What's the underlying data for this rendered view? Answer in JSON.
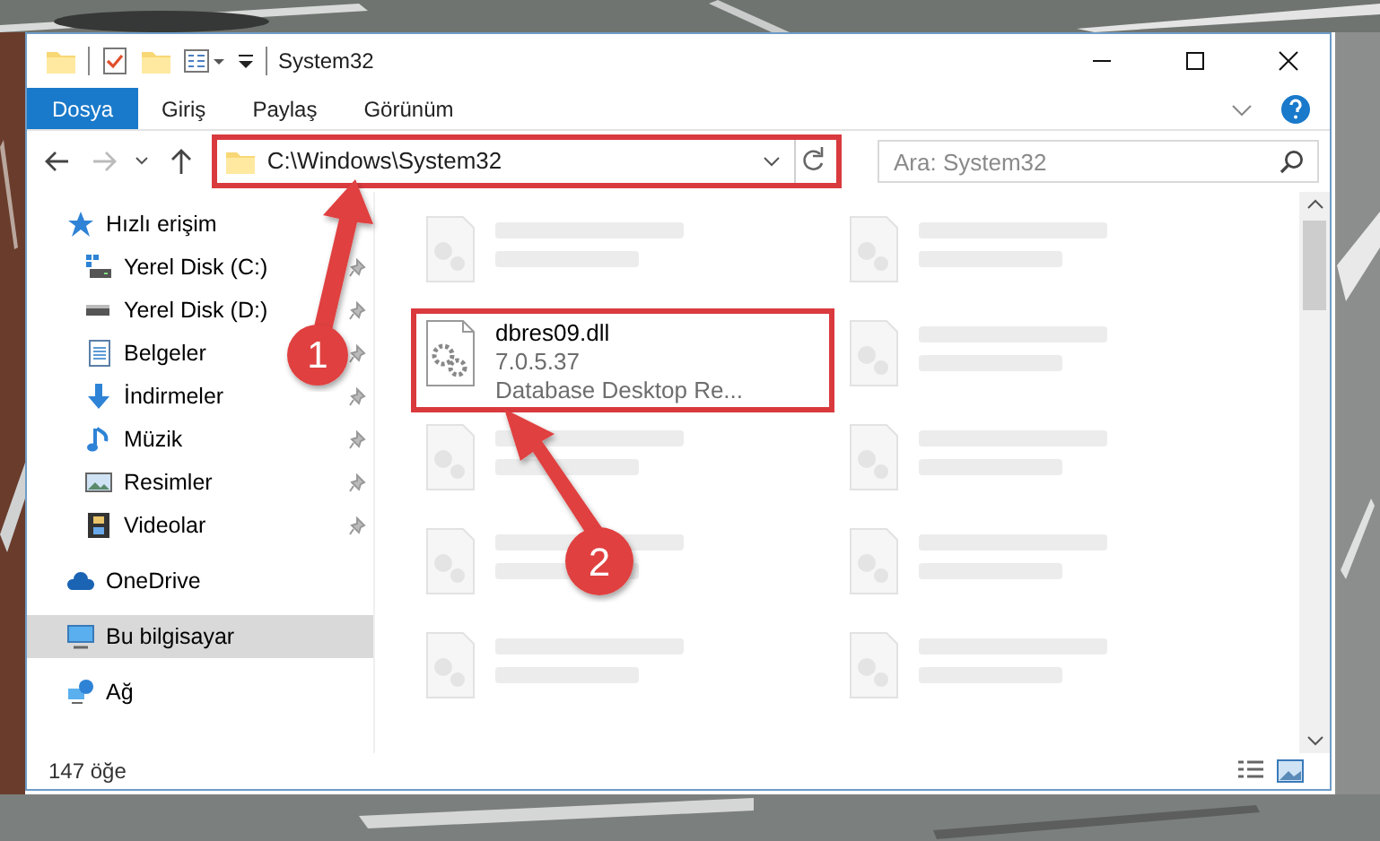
{
  "window": {
    "title": "System32"
  },
  "ribbon_tabs": [
    {
      "label": "Dosya",
      "kind": "file"
    },
    {
      "label": "Giriş",
      "kind": "tab"
    },
    {
      "label": "Paylaş",
      "kind": "tab"
    },
    {
      "label": "Görünüm",
      "kind": "tab"
    }
  ],
  "address": {
    "path": "C:\\Windows\\System32",
    "highlighted": true
  },
  "search": {
    "placeholder": "Ara: System32"
  },
  "sidebar": {
    "items": [
      {
        "label": "Hızlı erişim",
        "kind": "star",
        "selected": false,
        "children": [
          {
            "label": "Yerel Disk (C:)",
            "kind": "sysdrive",
            "pinned": true,
            "selected": false
          },
          {
            "label": "Yerel Disk (D:)",
            "kind": "drive",
            "pinned": true,
            "selected": false
          },
          {
            "label": "Belgeler",
            "kind": "docs",
            "pinned": true,
            "selected": false
          },
          {
            "label": "İndirmeler",
            "kind": "download",
            "pinned": true,
            "selected": false
          },
          {
            "label": "Müzik",
            "kind": "music",
            "pinned": true,
            "selected": false
          },
          {
            "label": "Resimler",
            "kind": "pictures",
            "pinned": true,
            "selected": false
          },
          {
            "label": "Videolar",
            "kind": "videos",
            "pinned": true,
            "selected": false
          }
        ]
      },
      {
        "label": "OneDrive",
        "kind": "cloud",
        "selected": false
      },
      {
        "label": "Bu bilgisayar",
        "kind": "pc",
        "selected": true
      },
      {
        "label": "Ağ",
        "kind": "network",
        "selected": false
      }
    ]
  },
  "files": [
    {
      "kind": "blurred",
      "highlighted": false
    },
    {
      "kind": "blurred",
      "highlighted": false
    },
    {
      "kind": "file",
      "name": "dbres09.dll",
      "details": [
        "7.0.5.37",
        "Database Desktop Re..."
      ],
      "highlighted": true
    },
    {
      "kind": "blurred",
      "highlighted": false
    },
    {
      "kind": "blurred",
      "highlighted": false
    },
    {
      "kind": "blurred",
      "highlighted": false
    },
    {
      "kind": "blurred",
      "highlighted": false
    },
    {
      "kind": "blurred",
      "highlighted": false
    },
    {
      "kind": "blurred",
      "highlighted": false
    },
    {
      "kind": "blurred",
      "highlighted": false
    }
  ],
  "annotations": [
    {
      "number": "1"
    },
    {
      "number": "2"
    }
  ],
  "status_bar": {
    "item_count": "147 öğe"
  }
}
